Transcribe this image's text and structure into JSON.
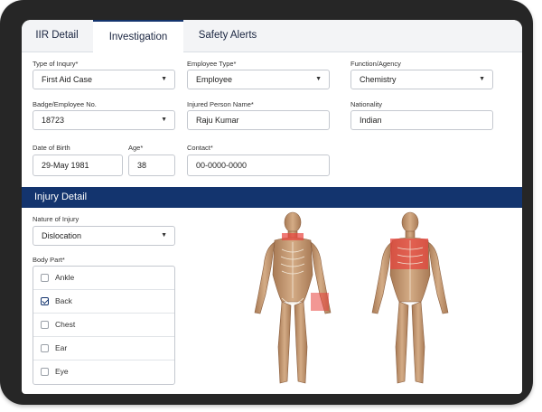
{
  "tabs": [
    {
      "label": "IIR Detail"
    },
    {
      "label": "Investigation"
    },
    {
      "label": "Safety Alerts"
    }
  ],
  "active_tab": "Investigation",
  "form": {
    "type_of_injury": {
      "label": "Type of Inqury*",
      "value": "First Aid Case"
    },
    "employee_type": {
      "label": "Employee Type*",
      "value": "Employee"
    },
    "function_agency": {
      "label": "Function/Agency",
      "value": "Chemistry"
    },
    "badge_no": {
      "label": "Badge/Employee No.",
      "value": "18723"
    },
    "injured_person_name": {
      "label": "Injured Person Name*",
      "value": "Raju Kumar"
    },
    "nationality": {
      "label": "Nationality",
      "value": "Indian"
    },
    "date_of_birth": {
      "label": "Date of Birth",
      "value": "29-May 1981"
    },
    "age": {
      "label": "Age*",
      "value": "38"
    },
    "contact": {
      "label": "Contact*",
      "value": "00-0000-0000"
    }
  },
  "injury_detail": {
    "title": "Injury Detail",
    "nature_of_injury": {
      "label": "Nature of Injury",
      "value": "Dislocation"
    },
    "body_part": {
      "label": "Body Part*",
      "items": [
        {
          "label": "Ankle",
          "checked": false
        },
        {
          "label": "Back",
          "checked": true
        },
        {
          "label": "Chest",
          "checked": false
        },
        {
          "label": "Ear",
          "checked": false
        },
        {
          "label": "Eye",
          "checked": false
        }
      ]
    }
  },
  "colors": {
    "device_frame": "#262626",
    "navy": "#13346e",
    "highlight": "#e8423c",
    "skin": "#c9a27e"
  },
  "icons": {
    "dropdown": "chevron-down-icon",
    "check": "checkmark-icon"
  }
}
